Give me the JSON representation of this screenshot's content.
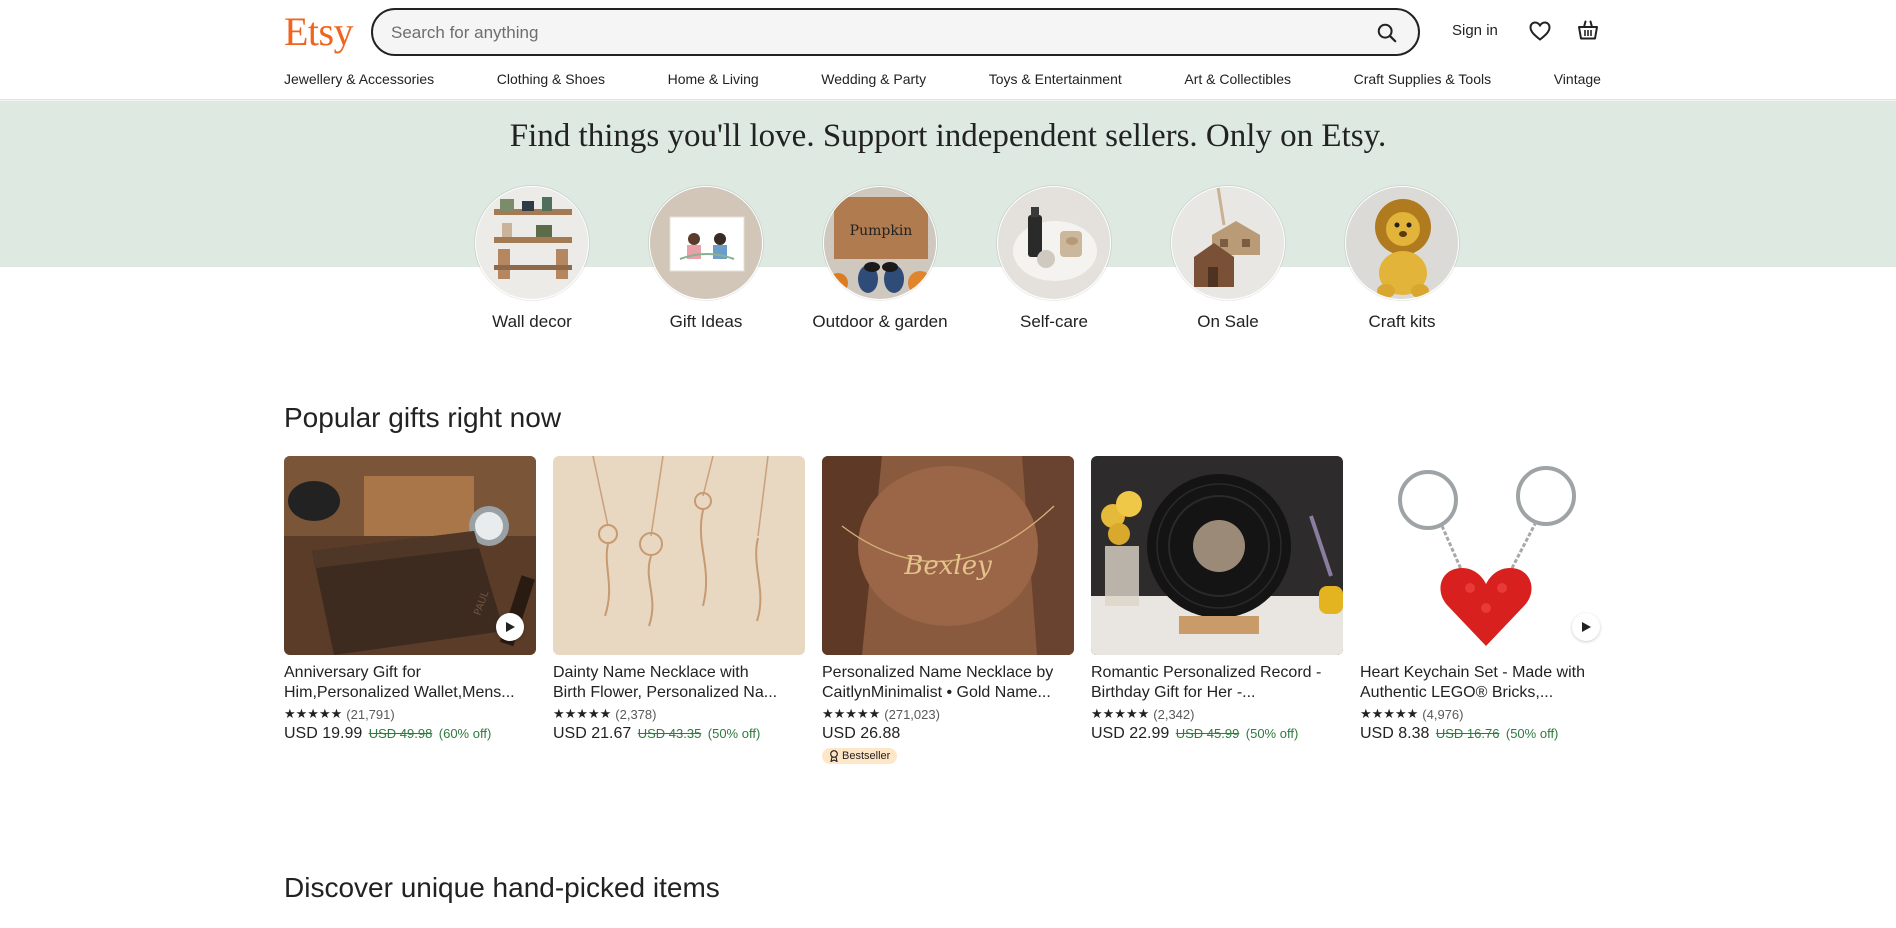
{
  "header": {
    "logo": "Etsy",
    "search_placeholder": "Search for anything",
    "signin_label": "Sign in",
    "search_icon": "search-icon",
    "favorites_icon": "heart-icon",
    "cart_icon": "shopping-basket-icon"
  },
  "categories": [
    "Jewellery & Accessories",
    "Clothing & Shoes",
    "Home & Living",
    "Wedding & Party",
    "Toys & Entertainment",
    "Art & Collectibles",
    "Craft Supplies & Tools",
    "Vintage"
  ],
  "hero": {
    "title": "Find things you'll love. Support independent sellers. Only on Etsy.",
    "circles": [
      {
        "label": "Wall decor"
      },
      {
        "label": "Gift Ideas"
      },
      {
        "label": "Outdoor & garden"
      },
      {
        "label": "Self-care"
      },
      {
        "label": "On Sale"
      },
      {
        "label": "Craft kits"
      }
    ]
  },
  "popular": {
    "title": "Popular gifts right now",
    "items": [
      {
        "title_line1": "Anniversary Gift for",
        "title_line2": "Him,Personalized Wallet,Mens...",
        "stars": "★★★★★",
        "reviews": "(21,791)",
        "price": "USD 19.99",
        "original": "USD 49.98",
        "discount": "(60% off)",
        "has_video": true
      },
      {
        "title_line1": "Dainty Name Necklace with",
        "title_line2": "Birth Flower, Personalized Na...",
        "stars": "★★★★★",
        "reviews": "(2,378)",
        "price": "USD 21.67",
        "original": "USD 43.35",
        "discount": "(50% off)",
        "has_video": false
      },
      {
        "title_line1": "Personalized Name Necklace by",
        "title_line2": "CaitlynMinimalist • Gold Name...",
        "stars": "★★★★★",
        "reviews": "(271,023)",
        "price": "USD 26.88",
        "original": "",
        "discount": "",
        "badge": "Bestseller",
        "has_video": false
      },
      {
        "title_line1": "Romantic Personalized Record -",
        "title_line2": "Birthday Gift for Her -...",
        "stars": "★★★★★",
        "reviews": "(2,342)",
        "price": "USD 22.99",
        "original": "USD 45.99",
        "discount": "(50% off)",
        "has_video": false
      },
      {
        "title_line1": "Heart Keychain Set - Made with",
        "title_line2": "Authentic LEGO® Bricks,...",
        "stars": "★★★★★",
        "reviews": "(4,976)",
        "price": "USD 8.38",
        "original": "USD 16.76",
        "discount": "(50% off)",
        "has_video": true
      }
    ]
  },
  "discover": {
    "title": "Discover unique hand-picked items"
  },
  "colors": {
    "brand": "#f1641e",
    "hero_band": "#dde9e1",
    "discount_green": "#2f7a3e",
    "badge_bg": "#fde7c7"
  }
}
